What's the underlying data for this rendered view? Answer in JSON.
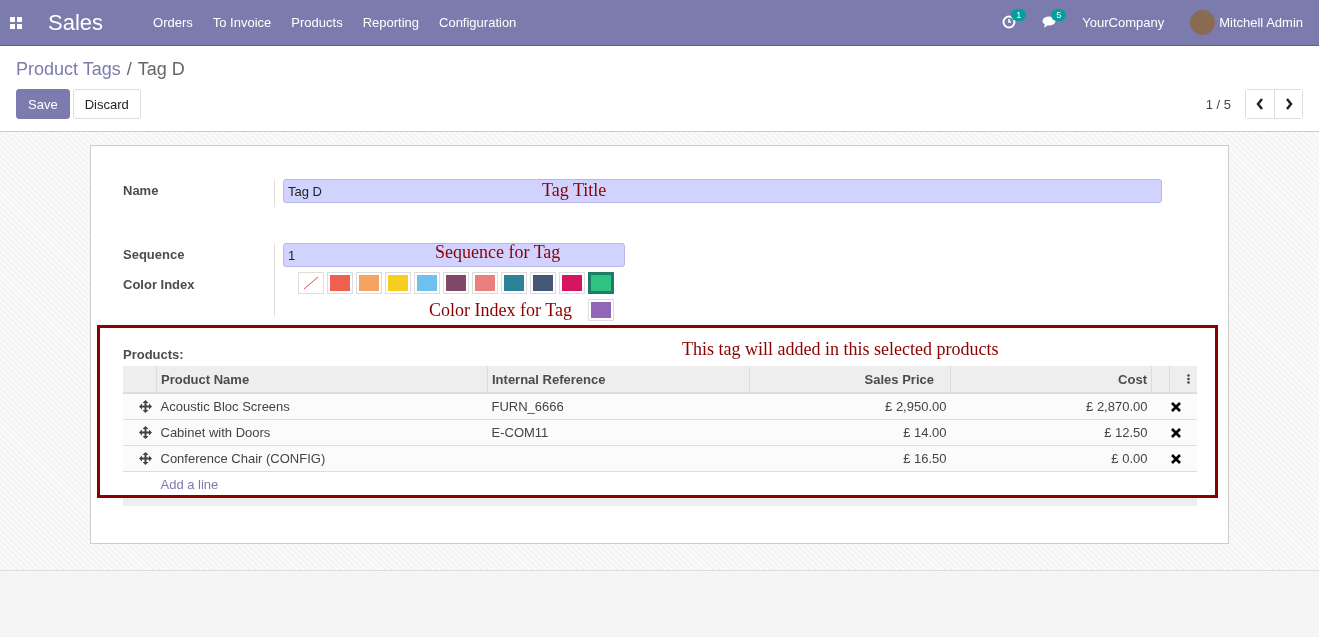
{
  "navbar": {
    "app_name": "Sales",
    "menu": [
      "Orders",
      "To Invoice",
      "Products",
      "Reporting",
      "Configuration"
    ],
    "activity_count": "1",
    "message_count": "5",
    "company": "YourCompany",
    "user": "Mitchell Admin"
  },
  "breadcrumb": {
    "parent": "Product Tags",
    "separator": "/",
    "current": "Tag D"
  },
  "buttons": {
    "save": "Save",
    "discard": "Discard"
  },
  "pager": {
    "value": "1 / 5"
  },
  "form": {
    "name_label": "Name",
    "name_value": "Tag D",
    "sequence_label": "Sequence",
    "sequence_value": "1",
    "color_label": "Color Index",
    "colors": [
      {
        "kind": "none",
        "color": "#ffffff",
        "selected": false
      },
      {
        "kind": "swatch",
        "color": "#f06050",
        "selected": false
      },
      {
        "kind": "swatch",
        "color": "#f4a460",
        "selected": false
      },
      {
        "kind": "swatch",
        "color": "#f7cd1f",
        "selected": false
      },
      {
        "kind": "swatch",
        "color": "#6cc1ed",
        "selected": false
      },
      {
        "kind": "swatch",
        "color": "#814968",
        "selected": false
      },
      {
        "kind": "swatch",
        "color": "#eb7e7f",
        "selected": false
      },
      {
        "kind": "swatch",
        "color": "#2c8397",
        "selected": false
      },
      {
        "kind": "swatch",
        "color": "#475577",
        "selected": false
      },
      {
        "kind": "swatch",
        "color": "#d6145f",
        "selected": false
      },
      {
        "kind": "swatch",
        "color": "#30c381",
        "selected": true
      },
      {
        "kind": "swatch",
        "color": "#9365b8",
        "selected": false
      }
    ],
    "products_label": "Products:",
    "table": {
      "columns": [
        "Product Name",
        "Internal Reference",
        "Sales Price",
        "Cost"
      ],
      "rows": [
        {
          "name": "Acoustic Bloc Screens",
          "reference": "FURN_6666",
          "sales_price": "£ 2,950.00",
          "cost": "£ 2,870.00"
        },
        {
          "name": "Cabinet with Doors",
          "reference": "E-COM11",
          "sales_price": "£ 14.00",
          "cost": "£ 12.50"
        },
        {
          "name": "Conference Chair (CONFIG)",
          "reference": "",
          "sales_price": "£ 16.50",
          "cost": "£ 0.00"
        }
      ],
      "add_line": "Add a line"
    }
  },
  "annotations": {
    "name_note": "Tag Title",
    "sequence_note": "Sequence for Tag",
    "color_index_note": "Color Index for Tag",
    "products_note": "This tag will added in this selected products"
  }
}
